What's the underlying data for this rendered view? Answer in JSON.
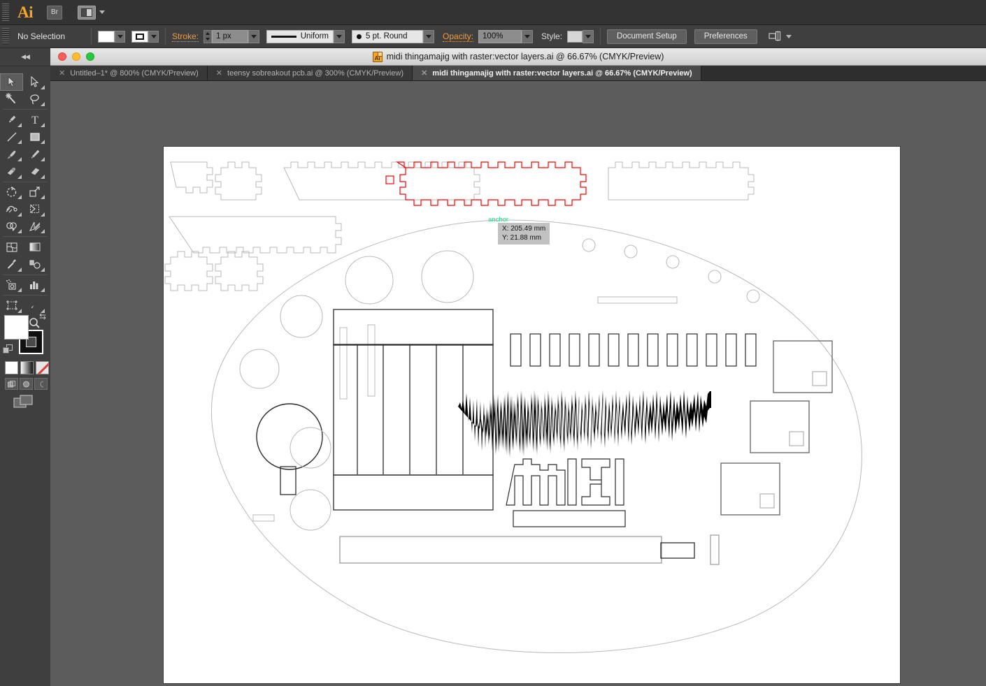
{
  "app": {
    "name": "Ai",
    "bridge_label": "Br",
    "arrange_icon": "arrange-documents-icon",
    "logo_icon": "illustrator-logo-icon"
  },
  "control_bar": {
    "selection_status": "No Selection",
    "fill_swatch_color": "#ffffff",
    "stroke_swatch_color": "#ffffff",
    "stroke_label": "Stroke:",
    "stroke_weight": "1 px",
    "profile_value": "Uniform",
    "brush_value": "5 pt. Round",
    "opacity_label": "Opacity:",
    "opacity_value": "100%",
    "style_label": "Style:",
    "style_swatch_color": "#d7d7d7",
    "document_setup_label": "Document Setup",
    "preferences_label": "Preferences",
    "align_icon": "align-objects-icon"
  },
  "toolbox": {
    "collapse_icon": "collapse-panel-icon",
    "tools": [
      {
        "name": "selection-tool",
        "active": true
      },
      {
        "name": "direct-selection-tool",
        "active": false
      },
      {
        "name": "magic-wand-tool",
        "active": false
      },
      {
        "name": "lasso-tool",
        "active": false
      },
      {
        "name": "pen-tool",
        "active": false
      },
      {
        "name": "type-tool",
        "active": false
      },
      {
        "name": "line-segment-tool",
        "active": false
      },
      {
        "name": "rectangle-tool",
        "active": false
      },
      {
        "name": "paintbrush-tool",
        "active": false
      },
      {
        "name": "pencil-tool",
        "active": false
      },
      {
        "name": "blob-brush-tool",
        "active": false
      },
      {
        "name": "eraser-tool",
        "active": false
      },
      {
        "name": "rotate-tool",
        "active": false
      },
      {
        "name": "scale-tool",
        "active": false
      },
      {
        "name": "width-tool",
        "active": false
      },
      {
        "name": "free-transform-tool",
        "active": false
      },
      {
        "name": "shape-builder-tool",
        "active": false
      },
      {
        "name": "perspective-grid-tool",
        "active": false
      },
      {
        "name": "mesh-tool",
        "active": false
      },
      {
        "name": "gradient-tool",
        "active": false
      },
      {
        "name": "eyedropper-tool",
        "active": false
      },
      {
        "name": "blend-tool",
        "active": false
      },
      {
        "name": "symbol-sprayer-tool",
        "active": false
      },
      {
        "name": "column-graph-tool",
        "active": false
      },
      {
        "name": "artboard-tool",
        "active": false
      },
      {
        "name": "slice-tool",
        "active": false
      },
      {
        "name": "hand-tool",
        "active": false
      },
      {
        "name": "zoom-tool",
        "active": false
      }
    ],
    "fill_color": "#ffffff",
    "stroke_color": "#000000",
    "swap_icon": "swap-fill-stroke-icon",
    "default_icon": "default-fill-stroke-icon",
    "fill_modes": [
      "solid-color-icon",
      "gradient-icon",
      "none-icon"
    ],
    "screen_modes": [
      "normal-screen-mode-icon",
      "full-screen-menubar-icon",
      "full-screen-icon"
    ],
    "change_screen_icon": "change-screen-mode-icon"
  },
  "document_window": {
    "title": "midi thingamajig with raster:vector layers.ai @ 66.67% (CMYK/Preview)",
    "title_icon": "ai-document-icon",
    "traffic_lights": [
      "close-button",
      "minimize-button",
      "zoom-button"
    ],
    "tabs": [
      {
        "label": "Untitled–1* @ 800% (CMYK/Preview)",
        "active": false
      },
      {
        "label": "teensy sobreakout pcb.ai @ 300% (CMYK/Preview)",
        "active": false
      },
      {
        "label": "midi thingamajig with raster:vector layers.ai @ 66.67% (CMYK/Preview)",
        "active": true
      }
    ],
    "close_tab_icon": "close-tab-icon"
  },
  "canvas": {
    "background_color": "#5c5c5c",
    "artboard_color": "#ffffff",
    "smart_guide": {
      "anchor_label": "anchor",
      "x_readout": "X: 205.49 mm",
      "y_readout": "Y: 21.88 mm",
      "anchor_color": "#00e676",
      "highlight_color": "#ff0000"
    },
    "artwork": {
      "description": "Laser cutting layout: box-joint tab panels along the top, a large rounded-oval enclosure face with knob holes, fader slot panel, LED button strip, audio waveform raster, MIDI logo outline, three IC squares and a long bottom slot.",
      "logo_text": "MIDI",
      "selected_piece_stroke": "#ff0000"
    }
  }
}
